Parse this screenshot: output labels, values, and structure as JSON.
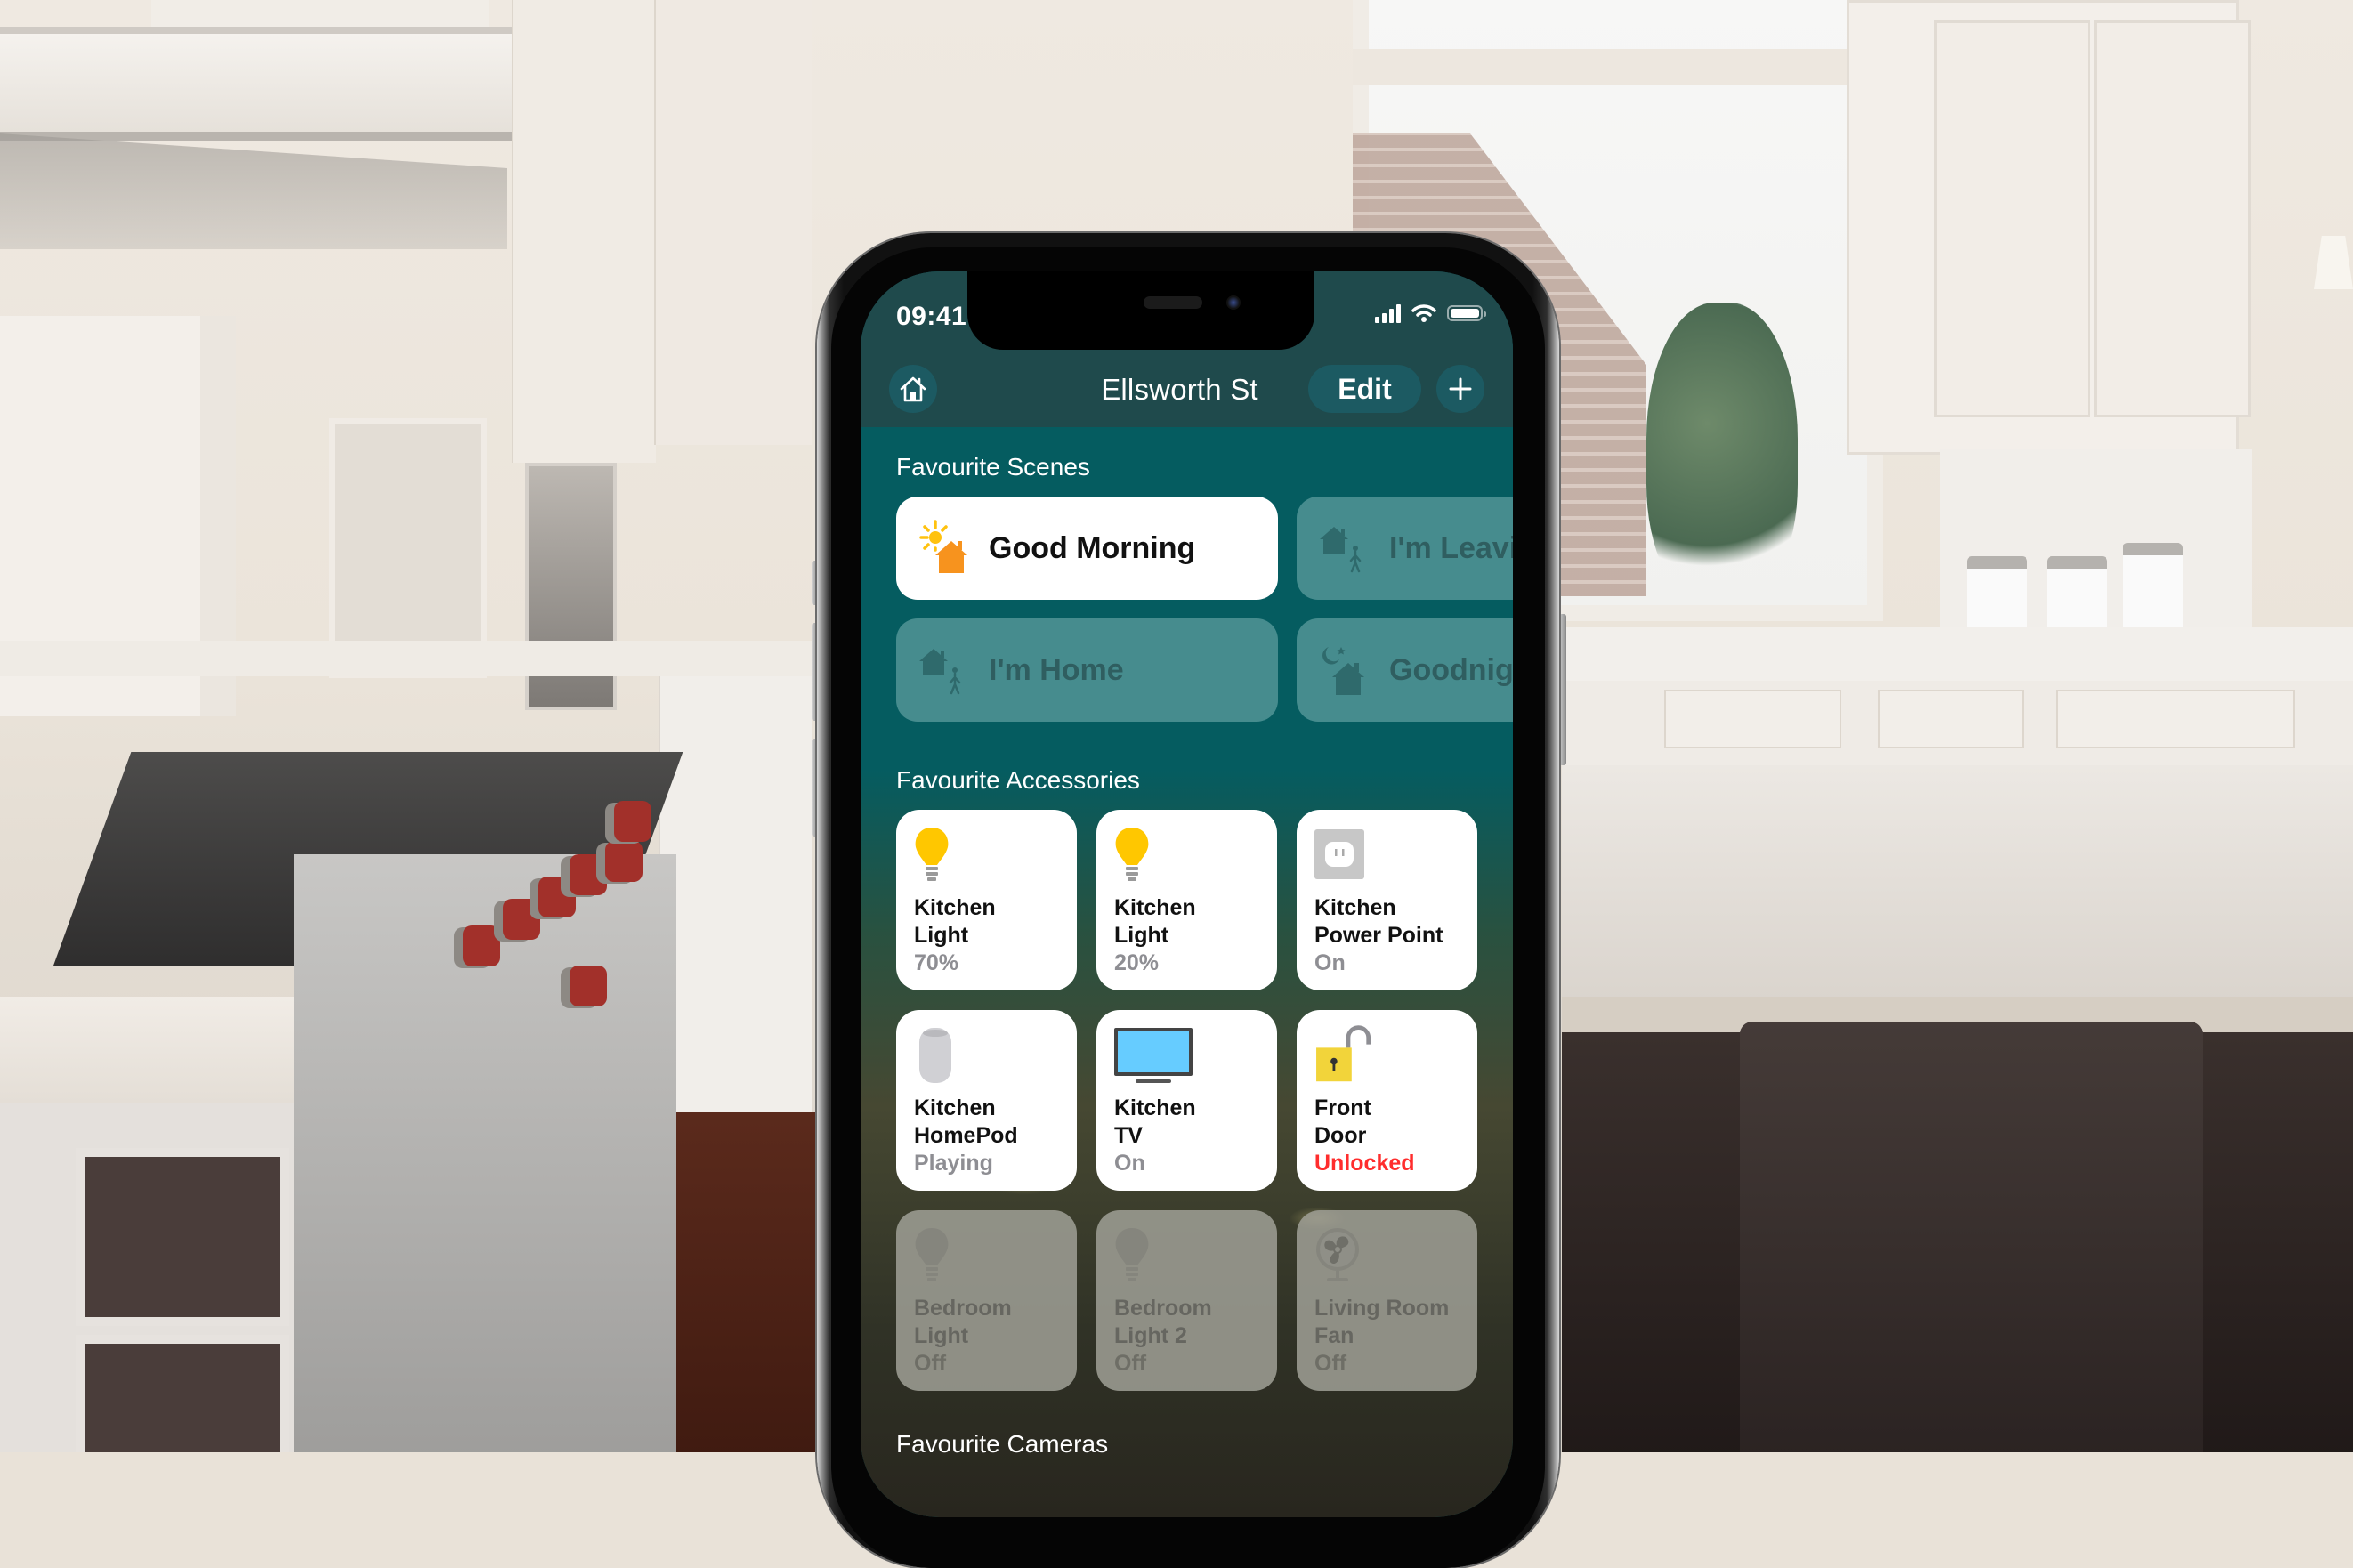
{
  "status_bar": {
    "time": "09:41",
    "signal_icon": "cellular-signal-icon",
    "wifi_icon": "wifi-icon",
    "battery_icon": "battery-icon"
  },
  "header": {
    "home_icon": "home-icon",
    "title": "Ellsworth St",
    "edit_label": "Edit",
    "add_icon": "plus-icon"
  },
  "scenes": {
    "label": "Favourite Scenes",
    "items": [
      {
        "label": "Good Morning",
        "icon": "sun-house-icon",
        "active": true
      },
      {
        "label": "I'm Leaving",
        "icon": "house-person-leaving-icon",
        "active": false
      },
      {
        "label": "I'm Home",
        "icon": "house-person-arriving-icon",
        "active": false
      },
      {
        "label": "Goodnight",
        "icon": "moon-house-icon",
        "active": false
      }
    ]
  },
  "accessories": {
    "label": "Favourite Accessories",
    "items": [
      {
        "name": "Kitchen Light",
        "state": "70%",
        "icon": "lightbulb-icon",
        "on": true
      },
      {
        "name": "Kitchen Light",
        "state": "20%",
        "icon": "lightbulb-icon",
        "on": true
      },
      {
        "name": "Kitchen Power Point",
        "state": "On",
        "icon": "power-outlet-icon",
        "on": true
      },
      {
        "name": "Kitchen HomePod",
        "state": "Playing",
        "icon": "homepod-icon",
        "on": true
      },
      {
        "name": "Kitchen TV",
        "state": "On",
        "icon": "tv-icon",
        "on": true
      },
      {
        "name": "Front Door",
        "state": "Unlocked",
        "icon": "unlocked-padlock-icon",
        "on": true,
        "alert": true
      },
      {
        "name": "Bedroom Light",
        "state": "Off",
        "icon": "lightbulb-icon",
        "on": false
      },
      {
        "name": "Bedroom Light 2",
        "state": "Off",
        "icon": "lightbulb-icon",
        "on": false
      },
      {
        "name": "Living Room Fan",
        "state": "Off",
        "icon": "fan-icon",
        "on": false
      }
    ]
  },
  "cameras": {
    "label": "Favourite Cameras"
  },
  "colors": {
    "header_bg": "#1f4a4c",
    "content_bg": "#055c60",
    "button_bg": "#1c5a62",
    "bulb_on": "#ffc700",
    "scene_icon_orange": "#f7931e",
    "alert_red": "#ff2d2d",
    "tv_screen": "#66ccff",
    "lock_yellow": "#f2d43a"
  }
}
